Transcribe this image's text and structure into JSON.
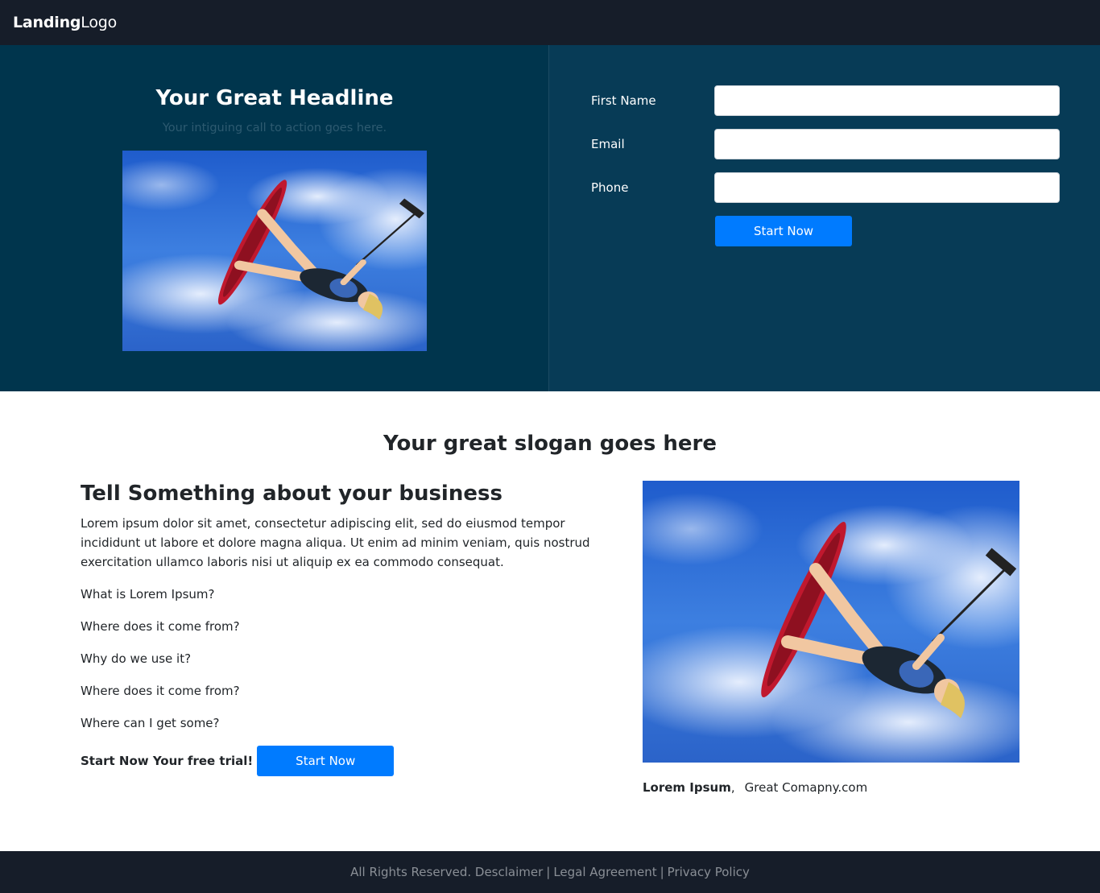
{
  "navbar": {
    "brand_bold": "Landing",
    "brand_rest": "Logo"
  },
  "hero": {
    "title": "Your Great Headline",
    "subtitle": "Your intiguing call to action goes here.",
    "image_alt": "kiteboarder jumping against blue sky",
    "form": {
      "first_name_label": "First Name",
      "first_name_value": "",
      "email_label": "Email",
      "email_value": "",
      "phone_label": "Phone",
      "phone_value": "",
      "submit_label": "Start Now"
    }
  },
  "content": {
    "slogan": "Your great slogan goes here",
    "about_title": "Tell Something about your business",
    "about_text": "Lorem ipsum dolor sit amet, consectetur adipiscing elit, sed do eiusmod tempor incididunt ut labore et dolore magna aliqua. Ut enim ad minim veniam, quis nostrud exercitation ullamco laboris nisi ut aliquip ex ea commodo consequat.",
    "faq": [
      "What is Lorem Ipsum?",
      "Where does it come from?",
      "Why do we use it?",
      "Where does it come from?",
      "Where can I get some?"
    ],
    "trial_text": "Start Now Your free trial!",
    "trial_button": "Start Now",
    "caption_bold": "Lorem Ipsum",
    "caption_comma": ",",
    "caption_rest": "Great Comapny.com"
  },
  "footer": {
    "rights": "All Rights Reserved.",
    "links": [
      "Desclaimer",
      "Legal Agreement",
      "Privacy Policy"
    ],
    "separator": "|"
  },
  "colors": {
    "navbar_bg": "#161d29",
    "hero_left_bg": "#00354d",
    "hero_right_bg": "#073b56",
    "primary": "#007bff"
  }
}
